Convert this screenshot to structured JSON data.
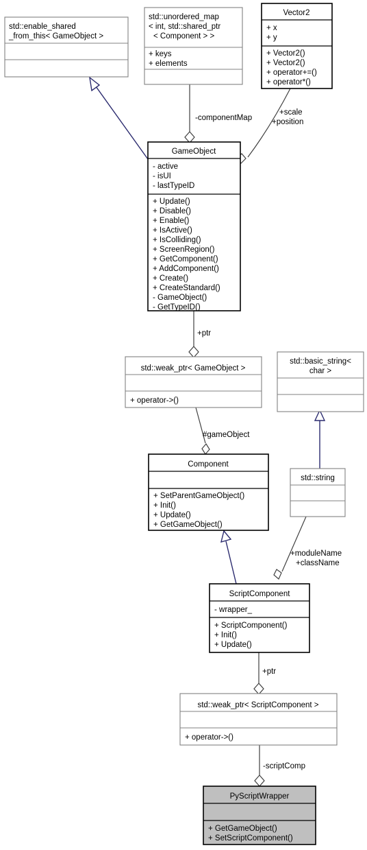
{
  "diagram": {
    "title": "GameObject / Component / ScriptComponent class collaboration diagram",
    "background_color": "#ffffff",
    "inheritance_color": "#2a2a6e",
    "association_color": "#404040",
    "highlight_fill": "#bfbfbf"
  },
  "classes": {
    "enable_shared": {
      "name_lines": [
        "std::enable_shared",
        "_from_this< GameObject >"
      ],
      "attributes": [],
      "operations": []
    },
    "unordered_map": {
      "name_lines": [
        "std::unordered_map",
        "< int, std::shared_ptr",
        "< Component > >"
      ],
      "attributes": [
        "+ keys",
        "+ elements"
      ],
      "operations": []
    },
    "vector2": {
      "name_lines": [
        "Vector2"
      ],
      "attributes": [
        "+ x",
        "+ y"
      ],
      "operations": [
        "+ Vector2()",
        "+ Vector2()",
        "+ operator+=()",
        "+ operator*()"
      ]
    },
    "gameobject": {
      "name_lines": [
        "GameObject"
      ],
      "attributes": [
        "- active",
        "- isUI",
        "- lastTypeID"
      ],
      "operations": [
        "+ Update()",
        "+ Disable()",
        "+ Enable()",
        "+ IsActive()",
        "+ IsColliding()",
        "+ ScreenRegion()",
        "+ GetComponent()",
        "+ AddComponent()",
        "+ Create()",
        "+ CreateStandard()",
        "- GameObject()",
        "- GetTypeID()"
      ]
    },
    "weakptr_gameobject": {
      "name_lines": [
        "std::weak_ptr< GameObject >"
      ],
      "attributes": [],
      "operations": [
        "+ operator->()"
      ]
    },
    "basic_string": {
      "name_lines": [
        "std::basic_string<",
        "char >"
      ],
      "attributes": [],
      "operations": []
    },
    "component": {
      "name_lines": [
        "Component"
      ],
      "attributes": [],
      "operations": [
        "+ SetParentGameObject()",
        "+ Init()",
        "+ Update()",
        "+ GetGameObject()"
      ]
    },
    "std_string": {
      "name_lines": [
        "std::string"
      ],
      "attributes": [],
      "operations": []
    },
    "scriptcomponent": {
      "name_lines": [
        "ScriptComponent"
      ],
      "attributes": [
        "- wrapper_"
      ],
      "operations": [
        "+ ScriptComponent()",
        "+ Init()",
        "+ Update()"
      ]
    },
    "weakptr_scriptcomponent": {
      "name_lines": [
        "std::weak_ptr< ScriptComponent >"
      ],
      "attributes": [],
      "operations": [
        "+ operator->()"
      ]
    },
    "pyscriptwrapper": {
      "name_lines": [
        "PyScriptWrapper"
      ],
      "attributes": [],
      "operations": [
        "+ GetGameObject()",
        "+ SetScriptComponent()"
      ]
    }
  },
  "edge_labels": {
    "component_map": "-componentMap",
    "scale_position_1": "+scale",
    "scale_position_2": "+position",
    "ptr_gameobject": "+ptr",
    "game_object_ref": "#gameObject",
    "module_name": "+moduleName",
    "class_name": "+className",
    "ptr_scriptcomponent": "+ptr",
    "script_comp": "-scriptComp"
  }
}
